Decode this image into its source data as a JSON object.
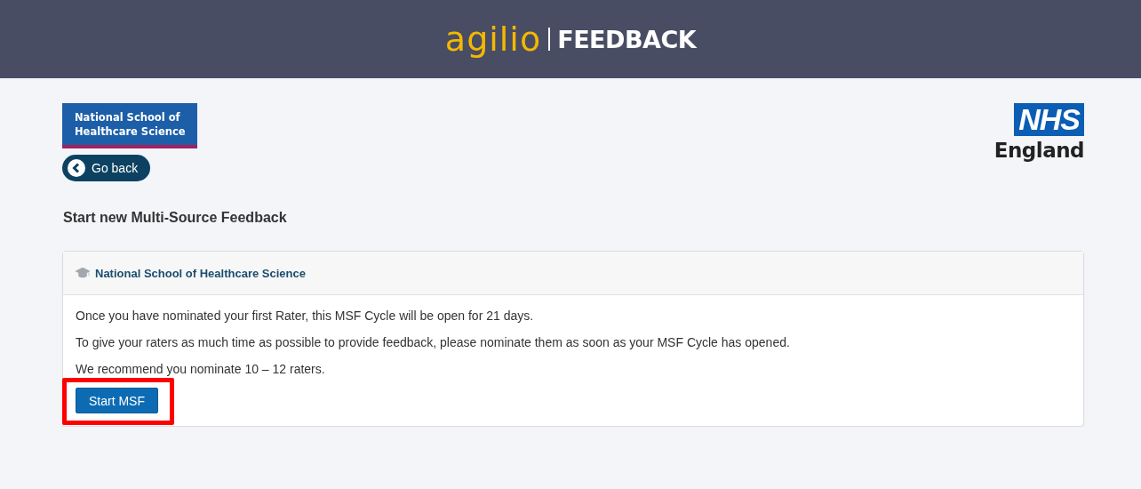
{
  "header": {
    "brand": "agilio",
    "product": "FEEDBACK"
  },
  "org_logo": {
    "lines": [
      "National School of",
      "Healthcare Science"
    ]
  },
  "partner_logo": {
    "badge": "NHS",
    "name": "England"
  },
  "back_button": {
    "label": "Go back"
  },
  "page_title": "Start new Multi-Source Feedback",
  "card": {
    "title": "National School of Healthcare Science",
    "paragraphs": [
      "Once you have nominated your first Rater, this MSF Cycle will be open for 21 days.",
      "To give your raters as much time as possible to provide feedback, please nominate them as soon as your MSF Cycle has opened.",
      "We recommend you nominate 10 – 12 raters."
    ],
    "button": {
      "label": "Start MSF",
      "highlighted": true
    }
  }
}
